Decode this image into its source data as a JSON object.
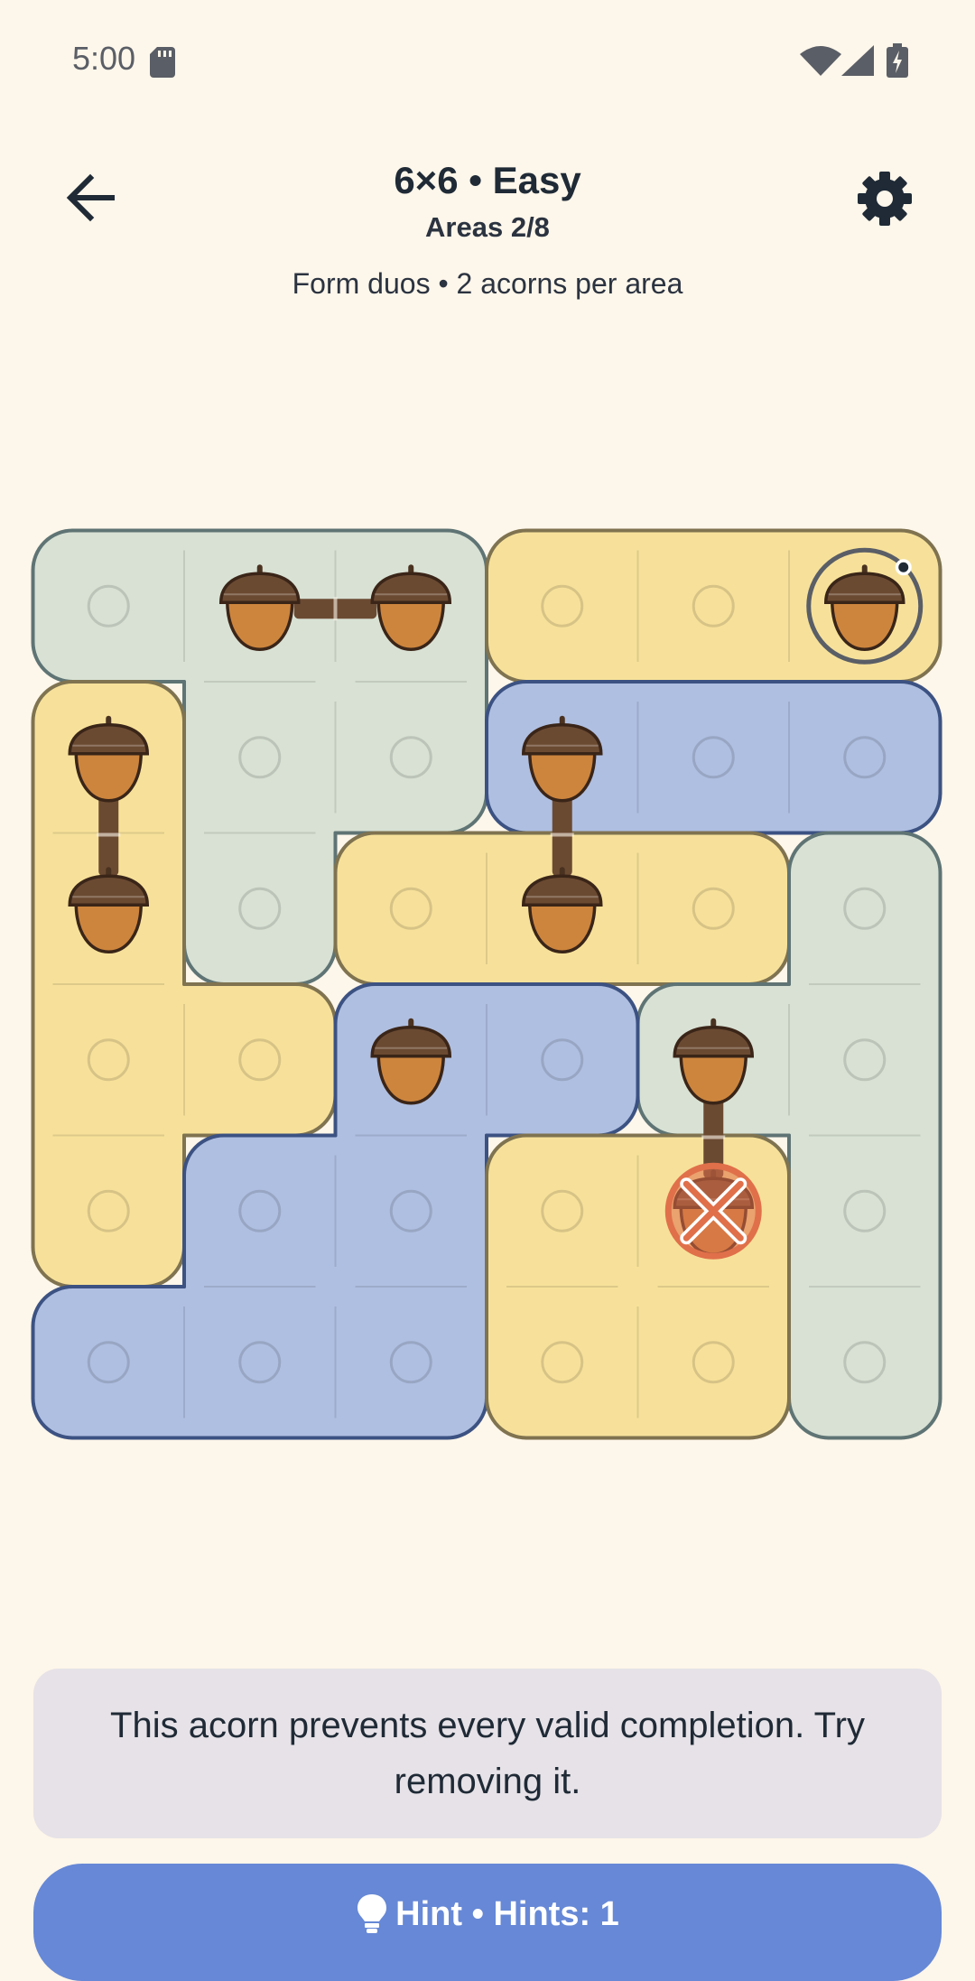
{
  "status_bar": {
    "time": "5:00",
    "icons": [
      "sd-card-icon",
      "wifi-icon",
      "cell-signal-icon",
      "battery-charging-icon"
    ]
  },
  "header": {
    "title": "6×6 • Easy",
    "subtitle": "Areas 2/8",
    "rules": "Form duos • 2 acorns per area",
    "back_icon": "arrow-left-icon",
    "settings_icon": "gear-icon"
  },
  "colors": {
    "background": "#fdf6ea",
    "green": "#d8e1d4",
    "green_border": "#5f7474",
    "yellow": "#f7e19a",
    "yellow_border": "#7f7350",
    "blue": "#afbfe1",
    "blue_border": "#3c5282",
    "acorn_cap": "#6b4a32",
    "acorn_body": "#cd853d",
    "link": "#6b4a32",
    "error": "#e0704a",
    "hint_button": "#6688d6",
    "message_card": "#e6e2e7"
  },
  "board": {
    "rows": 6,
    "cols": 6,
    "areas": [
      {
        "id": "A1",
        "color": "green",
        "cells": [
          [
            0,
            0
          ],
          [
            0,
            1
          ],
          [
            0,
            2
          ],
          [
            1,
            1
          ],
          [
            1,
            2
          ],
          [
            2,
            1
          ]
        ]
      },
      {
        "id": "A2",
        "color": "yellow",
        "cells": [
          [
            0,
            3
          ],
          [
            0,
            4
          ],
          [
            0,
            5
          ]
        ]
      },
      {
        "id": "A3",
        "color": "yellow",
        "cells": [
          [
            1,
            0
          ],
          [
            2,
            0
          ],
          [
            3,
            0
          ],
          [
            3,
            1
          ],
          [
            4,
            0
          ]
        ]
      },
      {
        "id": "A4",
        "color": "blue",
        "cells": [
          [
            1,
            3
          ],
          [
            1,
            4
          ],
          [
            1,
            5
          ]
        ]
      },
      {
        "id": "A5",
        "color": "yellow",
        "cells": [
          [
            2,
            2
          ],
          [
            2,
            3
          ],
          [
            2,
            4
          ]
        ]
      },
      {
        "id": "A6",
        "color": "green",
        "cells": [
          [
            2,
            5
          ],
          [
            3,
            4
          ],
          [
            3,
            5
          ],
          [
            4,
            5
          ],
          [
            5,
            5
          ]
        ]
      },
      {
        "id": "A7",
        "color": "blue",
        "cells": [
          [
            3,
            2
          ],
          [
            3,
            3
          ],
          [
            4,
            1
          ],
          [
            4,
            2
          ],
          [
            5,
            0
          ],
          [
            5,
            1
          ],
          [
            5,
            2
          ]
        ]
      },
      {
        "id": "A8",
        "color": "yellow",
        "cells": [
          [
            4,
            3
          ],
          [
            4,
            4
          ],
          [
            5,
            3
          ],
          [
            5,
            4
          ]
        ]
      }
    ],
    "acorns": [
      [
        0,
        1
      ],
      [
        0,
        2
      ],
      [
        0,
        5
      ],
      [
        1,
        0
      ],
      [
        2,
        0
      ],
      [
        1,
        3
      ],
      [
        2,
        3
      ],
      [
        3,
        2
      ],
      [
        3,
        4
      ],
      [
        4,
        4
      ]
    ],
    "links": [
      [
        [
          0,
          1
        ],
        [
          0,
          2
        ]
      ],
      [
        [
          1,
          0
        ],
        [
          2,
          0
        ]
      ],
      [
        [
          1,
          3
        ],
        [
          2,
          3
        ]
      ],
      [
        [
          3,
          4
        ],
        [
          4,
          4
        ]
      ]
    ],
    "selected": [
      0,
      5
    ],
    "error": [
      4,
      4
    ]
  },
  "message": {
    "text": "This acorn prevents every valid completion. Try removing it."
  },
  "hint_button": {
    "label": "Hint • Hints: 1",
    "icon": "lightbulb-icon"
  }
}
